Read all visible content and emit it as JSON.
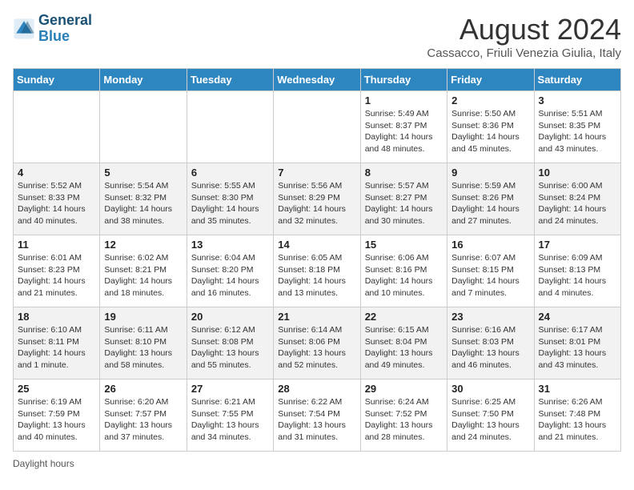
{
  "logo": {
    "line1": "General",
    "line2": "Blue"
  },
  "title": "August 2024",
  "subtitle": "Cassacco, Friuli Venezia Giulia, Italy",
  "days_of_week": [
    "Sunday",
    "Monday",
    "Tuesday",
    "Wednesday",
    "Thursday",
    "Friday",
    "Saturday"
  ],
  "weeks": [
    [
      null,
      null,
      null,
      null,
      {
        "day": 1,
        "sunrise": "5:49 AM",
        "sunset": "8:37 PM",
        "daylight": "14 hours and 48 minutes."
      },
      {
        "day": 2,
        "sunrise": "5:50 AM",
        "sunset": "8:36 PM",
        "daylight": "14 hours and 45 minutes."
      },
      {
        "day": 3,
        "sunrise": "5:51 AM",
        "sunset": "8:35 PM",
        "daylight": "14 hours and 43 minutes."
      }
    ],
    [
      {
        "day": 4,
        "sunrise": "5:52 AM",
        "sunset": "8:33 PM",
        "daylight": "14 hours and 40 minutes."
      },
      {
        "day": 5,
        "sunrise": "5:54 AM",
        "sunset": "8:32 PM",
        "daylight": "14 hours and 38 minutes."
      },
      {
        "day": 6,
        "sunrise": "5:55 AM",
        "sunset": "8:30 PM",
        "daylight": "14 hours and 35 minutes."
      },
      {
        "day": 7,
        "sunrise": "5:56 AM",
        "sunset": "8:29 PM",
        "daylight": "14 hours and 32 minutes."
      },
      {
        "day": 8,
        "sunrise": "5:57 AM",
        "sunset": "8:27 PM",
        "daylight": "14 hours and 30 minutes."
      },
      {
        "day": 9,
        "sunrise": "5:59 AM",
        "sunset": "8:26 PM",
        "daylight": "14 hours and 27 minutes."
      },
      {
        "day": 10,
        "sunrise": "6:00 AM",
        "sunset": "8:24 PM",
        "daylight": "14 hours and 24 minutes."
      }
    ],
    [
      {
        "day": 11,
        "sunrise": "6:01 AM",
        "sunset": "8:23 PM",
        "daylight": "14 hours and 21 minutes."
      },
      {
        "day": 12,
        "sunrise": "6:02 AM",
        "sunset": "8:21 PM",
        "daylight": "14 hours and 18 minutes."
      },
      {
        "day": 13,
        "sunrise": "6:04 AM",
        "sunset": "8:20 PM",
        "daylight": "14 hours and 16 minutes."
      },
      {
        "day": 14,
        "sunrise": "6:05 AM",
        "sunset": "8:18 PM",
        "daylight": "14 hours and 13 minutes."
      },
      {
        "day": 15,
        "sunrise": "6:06 AM",
        "sunset": "8:16 PM",
        "daylight": "14 hours and 10 minutes."
      },
      {
        "day": 16,
        "sunrise": "6:07 AM",
        "sunset": "8:15 PM",
        "daylight": "14 hours and 7 minutes."
      },
      {
        "day": 17,
        "sunrise": "6:09 AM",
        "sunset": "8:13 PM",
        "daylight": "14 hours and 4 minutes."
      }
    ],
    [
      {
        "day": 18,
        "sunrise": "6:10 AM",
        "sunset": "8:11 PM",
        "daylight": "14 hours and 1 minute."
      },
      {
        "day": 19,
        "sunrise": "6:11 AM",
        "sunset": "8:10 PM",
        "daylight": "13 hours and 58 minutes."
      },
      {
        "day": 20,
        "sunrise": "6:12 AM",
        "sunset": "8:08 PM",
        "daylight": "13 hours and 55 minutes."
      },
      {
        "day": 21,
        "sunrise": "6:14 AM",
        "sunset": "8:06 PM",
        "daylight": "13 hours and 52 minutes."
      },
      {
        "day": 22,
        "sunrise": "6:15 AM",
        "sunset": "8:04 PM",
        "daylight": "13 hours and 49 minutes."
      },
      {
        "day": 23,
        "sunrise": "6:16 AM",
        "sunset": "8:03 PM",
        "daylight": "13 hours and 46 minutes."
      },
      {
        "day": 24,
        "sunrise": "6:17 AM",
        "sunset": "8:01 PM",
        "daylight": "13 hours and 43 minutes."
      }
    ],
    [
      {
        "day": 25,
        "sunrise": "6:19 AM",
        "sunset": "7:59 PM",
        "daylight": "13 hours and 40 minutes."
      },
      {
        "day": 26,
        "sunrise": "6:20 AM",
        "sunset": "7:57 PM",
        "daylight": "13 hours and 37 minutes."
      },
      {
        "day": 27,
        "sunrise": "6:21 AM",
        "sunset": "7:55 PM",
        "daylight": "13 hours and 34 minutes."
      },
      {
        "day": 28,
        "sunrise": "6:22 AM",
        "sunset": "7:54 PM",
        "daylight": "13 hours and 31 minutes."
      },
      {
        "day": 29,
        "sunrise": "6:24 AM",
        "sunset": "7:52 PM",
        "daylight": "13 hours and 28 minutes."
      },
      {
        "day": 30,
        "sunrise": "6:25 AM",
        "sunset": "7:50 PM",
        "daylight": "13 hours and 24 minutes."
      },
      {
        "day": 31,
        "sunrise": "6:26 AM",
        "sunset": "7:48 PM",
        "daylight": "13 hours and 21 minutes."
      }
    ]
  ],
  "legend_label": "Daylight hours"
}
